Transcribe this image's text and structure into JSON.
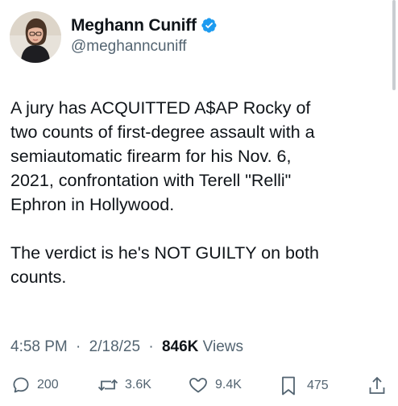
{
  "author": {
    "display_name": "Meghann Cuniff",
    "handle": "@meghanncuniff",
    "verified": true
  },
  "tweet": {
    "text": "A jury has ACQUITTED A$AP Rocky of\ntwo counts of first-degree assault with a\nsemiautomatic firearm for his Nov. 6,\n2021, confrontation with Terell \"Relli\"\nEphron in Hollywood.\n\nThe verdict is he's NOT GUILTY on both\ncounts."
  },
  "meta": {
    "time": "4:58 PM",
    "sep1": "·",
    "date": "2/18/25",
    "sep2": "·",
    "views_count": "846K",
    "views_label": "Views"
  },
  "actions": {
    "replies": "200",
    "reposts": "3.6K",
    "likes": "9.4K",
    "bookmarks": "475"
  },
  "icons": {
    "verified": "verified-badge-icon",
    "reply": "reply-icon",
    "repost": "repost-icon",
    "like": "heart-icon",
    "bookmark": "bookmark-icon",
    "share": "share-icon"
  },
  "colors": {
    "text": "#0f1419",
    "secondary": "#536471",
    "verified_blue": "#1d9bf0"
  }
}
